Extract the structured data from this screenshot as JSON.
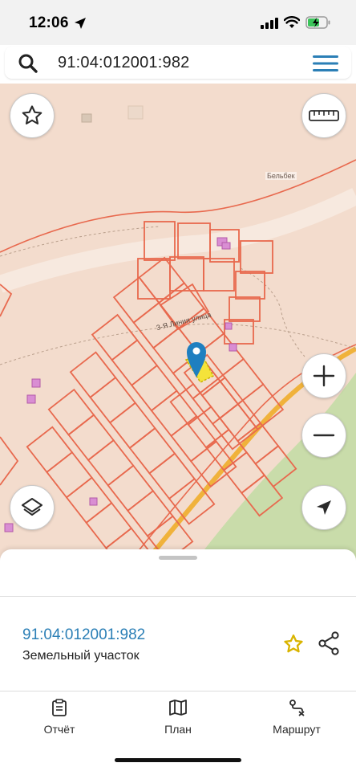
{
  "status_bar": {
    "time": "12:06"
  },
  "search": {
    "query": "91:04:012001:982"
  },
  "map": {
    "labels": {
      "village": "Бельбек",
      "street": "3-Я Линия улица"
    }
  },
  "sheet": {
    "parcel_id": "91:04:012001:982",
    "parcel_type": "Земельный участок"
  },
  "tabs": [
    {
      "label": "Отчёт",
      "icon": "report-icon"
    },
    {
      "label": "План",
      "icon": "map-icon"
    },
    {
      "label": "Маршрут",
      "icon": "route-icon"
    }
  ],
  "colors": {
    "accent": "#2b7fb6",
    "parcel_border": "#e8694e",
    "map_background": "#f3dccd",
    "selected_parcel": "#f4e33a",
    "road": "#f0b23b",
    "green_area": "#c9dcaa",
    "favorite_star": "#d9b400"
  }
}
